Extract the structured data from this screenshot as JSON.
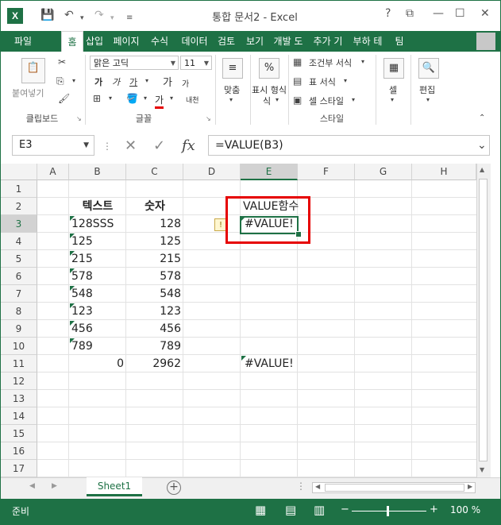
{
  "titlebar": {
    "app_logo": "X",
    "title": "통합 문서2 - Excel",
    "help": "?",
    "restore": "⧉",
    "minimize": "—",
    "maximize": "☐",
    "close": "✕"
  },
  "tabs": [
    "파일",
    "홈",
    "삽입",
    "페이지",
    "수식",
    "데이터",
    "검토",
    "보기",
    "개발 도",
    "추가 기",
    "부하 테",
    "팀"
  ],
  "ribbon": {
    "clipboard": {
      "paste": "붙여넣기",
      "label": "클립보드"
    },
    "font": {
      "name": "맑은 고딕",
      "size": "11",
      "label": "글꼴",
      "bold": "가",
      "italic": "가",
      "underline": "가",
      "grow": "가",
      "shrink": "가",
      "phonetic": "내천",
      "fontcolor": "가"
    },
    "align": {
      "label": "맞춤"
    },
    "number": {
      "label": "표시 형식",
      "pct": "%",
      "label2": "식"
    },
    "styles": {
      "cond": "조건부 서식",
      "table": "표 서식",
      "cell": "셀 스타일",
      "label": "스타일"
    },
    "cells": {
      "label": "셀"
    },
    "edit": {
      "label": "편집"
    }
  },
  "formula_bar": {
    "namebox": "E3",
    "fx": "fx",
    "formula": "=VALUE(B3)"
  },
  "columns": [
    "A",
    "B",
    "C",
    "D",
    "E",
    "F",
    "G",
    "H"
  ],
  "rows": [
    "1",
    "2",
    "3",
    "4",
    "5",
    "6",
    "7",
    "8",
    "9",
    "10",
    "11",
    "12",
    "13",
    "14",
    "15",
    "16",
    "17"
  ],
  "cells": {
    "B2": "텍스트",
    "C2": "숫자",
    "E2": "VALUE함수",
    "B3": "128SSS",
    "C3": "128",
    "E3": "#VALUE!",
    "B4": "125",
    "C4": "125",
    "B5": "215",
    "C5": "215",
    "B6": "578",
    "C6": "578",
    "B7": "548",
    "C7": "548",
    "B8": "123",
    "C8": "123",
    "B9": "456",
    "C9": "456",
    "B10": "789",
    "C10": "789",
    "B11": "0",
    "C11": "2962",
    "E11": "#VALUE!"
  },
  "sheet": {
    "tab": "Sheet1",
    "add": "+"
  },
  "status": {
    "mode": "준비",
    "zoom": "100 %",
    "minus": "−",
    "plus": "+"
  },
  "colors": {
    "accent": "#1e7145",
    "highlight": "#e60000"
  }
}
